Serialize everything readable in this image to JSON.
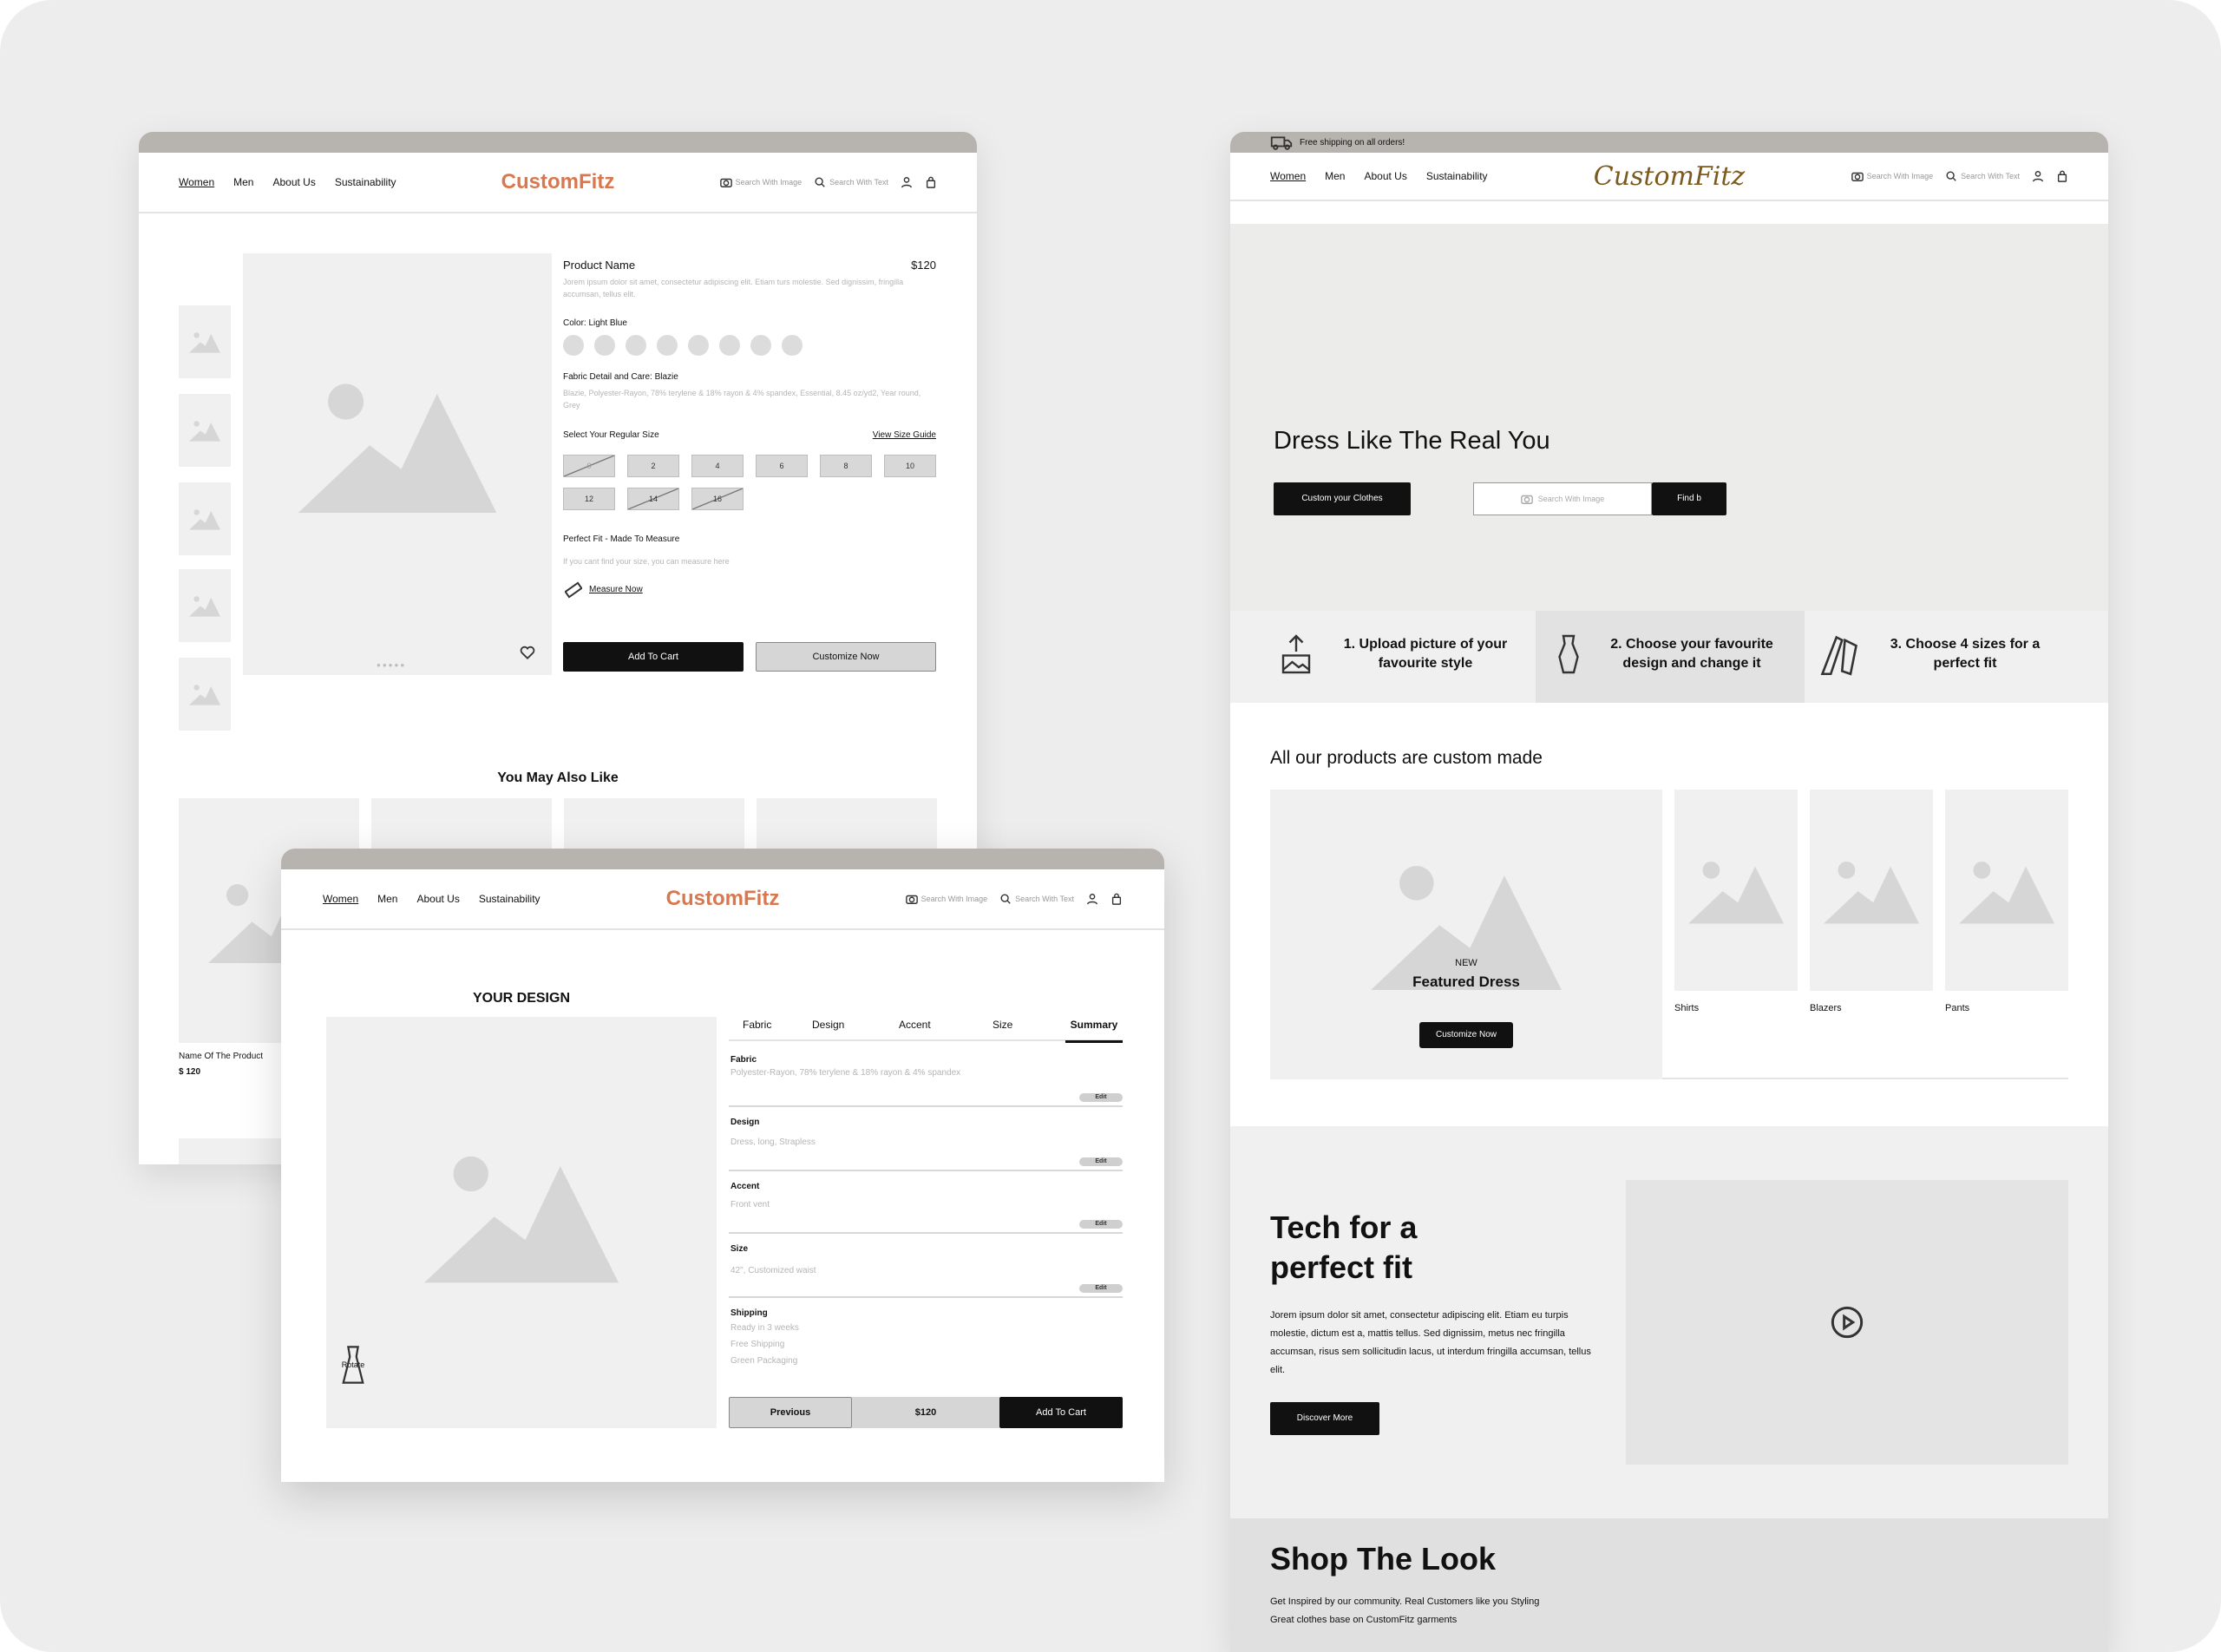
{
  "nav": {
    "links": [
      "Women",
      "Men",
      "About Us",
      "Sustainability"
    ],
    "logo": "CustomFitz",
    "search_image": "Search With Image",
    "search_text": "Search With Text"
  },
  "product_page": {
    "product_name": "Product Name",
    "price": "$120",
    "description": "Jorem ipsum dolor sit amet, consectetur adipiscing elit. Etiam turs molestie. Sed dignissim, fringilla accumsan, tellus elit.",
    "color_label": "Color: Light Blue",
    "fabric_label": "Fabric Detail and Care: Blazie",
    "fabric_desc": "Blazie, Polyester-Rayon, 78% terylene & 18% rayon & 4% spandex, Essential, 8.45 oz/yd2, Year round, Grey",
    "size_label": "Select Your Regular Size",
    "size_guide": "View Size Guide",
    "sizes": [
      "0",
      "2",
      "4",
      "6",
      "8",
      "10",
      "12",
      "14",
      "16"
    ],
    "perfect_fit_label": "Perfect Fit - Made To Measure",
    "perfect_fit_desc": "If you cant find your size, you can measure here",
    "measure_now": "Measure Now",
    "add_to_cart": "Add To Cart",
    "customize_now": "Customize Now",
    "you_may_also_like": "You May Also Like",
    "rec_name": "Name Of The Product",
    "rec_price": "$ 120"
  },
  "design_page": {
    "title": "YOUR DESIGN",
    "rotate": "Rotate",
    "tabs": [
      "Fabric",
      "Design",
      "Accent",
      "Size",
      "Summary"
    ],
    "sections": [
      {
        "label": "Fabric",
        "value": "Polyester-Rayon, 78% terylene & 18% rayon & 4% spandex"
      },
      {
        "label": "Design",
        "value": "Dress, long, Strapless"
      },
      {
        "label": "Accent",
        "value": "Front vent"
      },
      {
        "label": "Size",
        "value": "42\", Customized waist"
      }
    ],
    "edit": "Edit",
    "shipping_label": "Shipping",
    "shipping_lines": [
      "Ready in 3 weeks",
      "Free Shipping",
      "Green Packaging"
    ],
    "previous": "Previous",
    "price": "$120",
    "add_to_cart": "Add To Cart"
  },
  "home_page": {
    "banner": "Free shipping on all orders!",
    "hero_title": "Dress Like The Real You",
    "custom_btn": "Custom your Clothes",
    "search_placeholder": "Search With Image",
    "find_btn": "Find b",
    "steps": [
      {
        "line1": "1. Upload picture of your",
        "line2": "favourite style"
      },
      {
        "line1": "2. Choose your favourite",
        "line2": "design and change it"
      },
      {
        "line1": "3. Choose 4 sizes for a",
        "line2": "perfect fit"
      }
    ],
    "products_title": "All our products are custom made",
    "new_label": "NEW",
    "featured": "Featured Dress",
    "customize_now": "Customize Now",
    "categories": [
      "Shirts",
      "Blazers",
      "Pants"
    ],
    "tech_title_1": "Tech for a",
    "tech_title_2": "perfect fit",
    "tech_desc": "Jorem ipsum dolor sit amet, consectetur adipiscing elit. Etiam eu turpis molestie, dictum est a, mattis tellus. Sed dignissim, metus nec fringilla accumsan, risus sem sollicitudin lacus, ut interdum fringilla accumsan, tellus elit.",
    "discover": "Discover More",
    "shop_title": "Shop The Look",
    "shop_desc_1": "Get Inspired by our community. Real Customers like you Styling",
    "shop_desc_2": "Great clothes base on CustomFitz garments"
  }
}
